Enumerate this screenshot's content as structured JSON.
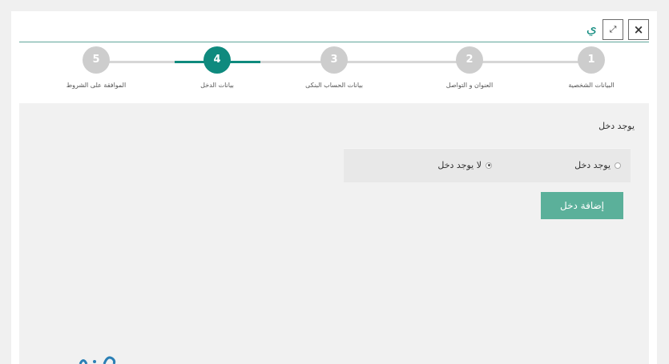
{
  "header": {
    "title": "ي",
    "close_symbol": "×",
    "expand_symbol": "⤢"
  },
  "stepper": {
    "steps": [
      {
        "number": "1",
        "label": "البيانات الشخصية",
        "state": "pending"
      },
      {
        "number": "2",
        "label": "العنوان و التواصل",
        "state": "pending"
      },
      {
        "number": "3",
        "label": "بيانات الحساب البنكى",
        "state": "pending"
      },
      {
        "number": "4",
        "label": "بيانات الدخل",
        "state": "active"
      },
      {
        "number": "5",
        "label": "الموافقة على الشروط",
        "state": "pending"
      }
    ]
  },
  "form": {
    "question": "يوجد دخل",
    "options": [
      {
        "label": "يوجد دخل",
        "checked": false
      },
      {
        "label": "لا يوجد دخل",
        "checked": true
      }
    ],
    "add_button": "إضافة دخل"
  },
  "colors": {
    "accent": "#0f8a7e",
    "button": "#5bb09a",
    "inactive_step": "#cdcdcd"
  }
}
